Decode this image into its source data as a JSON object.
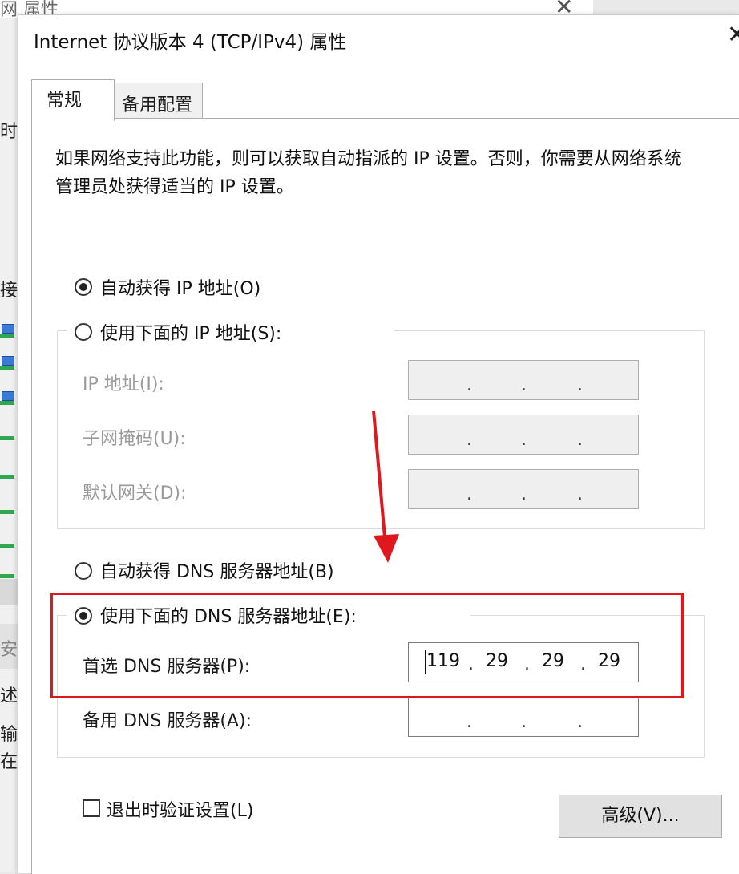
{
  "background_window": {
    "title_fragment": "网 属性",
    "strip_fragments": [
      "时",
      "接",
      "安",
      "述",
      "输",
      "在"
    ]
  },
  "dialog": {
    "title": "Internet 协议版本 4 (TCP/IPv4) 属性",
    "close_glyph": "✕"
  },
  "tabs": {
    "general": "常规",
    "alternate": "备用配置"
  },
  "description": "如果网络支持此功能，则可以获取自动指派的 IP 设置。否则，你需要从网络系统管理员处获得适当的 IP 设置。",
  "ip": {
    "auto_label": "自动获得 IP 地址(O)",
    "manual_label": "使用下面的 IP 地址(S):",
    "auto_selected": true,
    "fields": {
      "ip_label": "IP 地址(I):",
      "mask_label": "子网掩码(U):",
      "gateway_label": "默认网关(D):"
    }
  },
  "dns": {
    "auto_label": "自动获得 DNS 服务器地址(B)",
    "manual_label": "使用下面的 DNS 服务器地址(E):",
    "manual_selected": true,
    "preferred_label": "首选 DNS 服务器(P):",
    "preferred_octets": [
      "119",
      "29",
      "29",
      "29"
    ],
    "alternate_label": "备用 DNS 服务器(A):"
  },
  "validate_label": "退出时验证设置(L)",
  "validate_checked": false,
  "advanced_label": "高级(V)...",
  "ip_separator": ".",
  "colors": {
    "annotation_red": "#e0181e",
    "disabled_text": "#9a9a9a",
    "disabled_field": "#efefef"
  }
}
